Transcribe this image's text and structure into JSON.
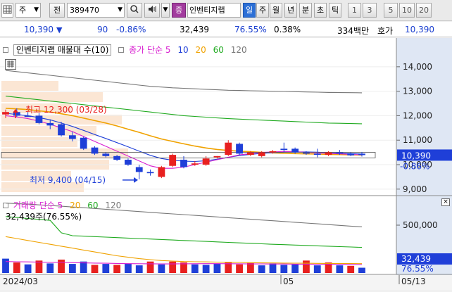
{
  "toolbar": {
    "market_type": "주",
    "code_mode": "전",
    "stock_code": "389470",
    "flag_label": "증",
    "stock_name": "인벤티지랩",
    "periods": [
      "일",
      "주",
      "월",
      "년",
      "분",
      "초",
      "틱"
    ],
    "active_period": "일",
    "intervals": [
      "1",
      "3",
      "5",
      "10",
      "20"
    ]
  },
  "quote": {
    "price": "10,390",
    "direction_arrow": "▼",
    "change": "90",
    "change_pct": "-0.86%",
    "volume": "32,439",
    "volume_ratio": "76.55%",
    "turnover_rate": "0.38%",
    "trade_value": "334백만",
    "ask_label": "호가",
    "ask_price": "10,390"
  },
  "price_panel": {
    "title": "인벤티지랩 매물대 수(10)",
    "ma_label": "종가 단순 5",
    "ma_periods": [
      "10",
      "20",
      "60",
      "120"
    ],
    "high_annotation": "최고 12,300 (03/28)",
    "low_annotation": "최저 9,400 (04/15)",
    "current_price_tag": "10,390",
    "current_change_tag": "-0.86%"
  },
  "volume_panel": {
    "title": "거래량 단순 5",
    "ma_periods": [
      "20",
      "60",
      "120"
    ],
    "current_label": "32,439주(76.55%)",
    "current_value_tag": "32,439",
    "current_pct_tag": "76.55%"
  },
  "x_axis": {
    "labels": [
      "2024/03",
      "05",
      "05/13"
    ]
  },
  "colors": {
    "up": "#e8201f",
    "down": "#1f3fd8",
    "ma5": "#d81fd0",
    "ma10": "#1f3fd8",
    "ma20": "#f0a200",
    "ma60": "#1faa1f",
    "ma120": "#777777",
    "current_tag": "#1f3fd8"
  },
  "chart_data": {
    "type": "candlestick",
    "price_axis": {
      "ticks": [
        9000,
        10000,
        11000,
        12000,
        13000,
        14000
      ],
      "tick_labels": [
        "9,000",
        "10,000",
        "11,000",
        "12,000",
        "13,000",
        "14,000"
      ],
      "ylim": [
        8850,
        14600
      ]
    },
    "volume_axis": {
      "ticks": [
        500000,
        1000000
      ],
      "tick_labels": [
        "500,000"
      ],
      "ylim": [
        0,
        750000
      ]
    },
    "candles": [
      {
        "o": 12050,
        "h": 12250,
        "l": 11900,
        "c": 12150
      },
      {
        "o": 12150,
        "h": 12300,
        "l": 11950,
        "c": 12000
      },
      {
        "o": 12000,
        "h": 12150,
        "l": 11950,
        "c": 11950
      },
      {
        "o": 12000,
        "h": 12100,
        "l": 11650,
        "c": 11700
      },
      {
        "o": 11700,
        "h": 11850,
        "l": 11450,
        "c": 11600
      },
      {
        "o": 11650,
        "h": 11750,
        "l": 11150,
        "c": 11200
      },
      {
        "o": 11200,
        "h": 11350,
        "l": 10950,
        "c": 11050
      },
      {
        "o": 11100,
        "h": 11150,
        "l": 10600,
        "c": 10650
      },
      {
        "o": 10700,
        "h": 10750,
        "l": 10400,
        "c": 10450
      },
      {
        "o": 10450,
        "h": 10500,
        "l": 10300,
        "c": 10350
      },
      {
        "o": 10350,
        "h": 10400,
        "l": 10150,
        "c": 10200
      },
      {
        "o": 10200,
        "h": 10250,
        "l": 9950,
        "c": 10000
      },
      {
        "o": 9900,
        "h": 10000,
        "l": 9400,
        "c": 9700
      },
      {
        "o": 9700,
        "h": 9800,
        "l": 9550,
        "c": 9650
      },
      {
        "o": 9500,
        "h": 9950,
        "l": 9450,
        "c": 9900
      },
      {
        "o": 9950,
        "h": 10450,
        "l": 9900,
        "c": 10400
      },
      {
        "o": 10200,
        "h": 10350,
        "l": 9850,
        "c": 9900
      },
      {
        "o": 10000,
        "h": 10150,
        "l": 9950,
        "c": 10050
      },
      {
        "o": 10000,
        "h": 10350,
        "l": 9950,
        "c": 10250
      },
      {
        "o": 10300,
        "h": 10350,
        "l": 10250,
        "c": 10350
      },
      {
        "o": 10400,
        "h": 11000,
        "l": 10350,
        "c": 10900
      },
      {
        "o": 10850,
        "h": 10900,
        "l": 10400,
        "c": 10450
      },
      {
        "o": 10400,
        "h": 10550,
        "l": 10350,
        "c": 10500
      },
      {
        "o": 10350,
        "h": 10550,
        "l": 10300,
        "c": 10500
      },
      {
        "o": 10500,
        "h": 10600,
        "l": 10450,
        "c": 10550
      },
      {
        "o": 10650,
        "h": 10900,
        "l": 10500,
        "c": 10600
      },
      {
        "o": 10650,
        "h": 10700,
        "l": 10450,
        "c": 10500
      },
      {
        "o": 10500,
        "h": 10550,
        "l": 10400,
        "c": 10450
      },
      {
        "o": 10450,
        "h": 10650,
        "l": 10300,
        "c": 10400
      },
      {
        "o": 10400,
        "h": 10550,
        "l": 10350,
        "c": 10500
      },
      {
        "o": 10500,
        "h": 10600,
        "l": 10400,
        "c": 10450
      },
      {
        "o": 10450,
        "h": 10500,
        "l": 10350,
        "c": 10380
      },
      {
        "o": 10450,
        "h": 10520,
        "l": 10330,
        "c": 10390
      }
    ],
    "volume": [
      {
        "v": 150000,
        "up": false
      },
      {
        "v": 110000,
        "up": true
      },
      {
        "v": 90000,
        "up": false
      },
      {
        "v": 130000,
        "up": true
      },
      {
        "v": 100000,
        "up": false
      },
      {
        "v": 140000,
        "up": true
      },
      {
        "v": 95000,
        "up": false
      },
      {
        "v": 120000,
        "up": false
      },
      {
        "v": 85000,
        "up": true
      },
      {
        "v": 95000,
        "up": false
      },
      {
        "v": 85000,
        "up": true
      },
      {
        "v": 100000,
        "up": false
      },
      {
        "v": 80000,
        "up": false
      },
      {
        "v": 120000,
        "up": true
      },
      {
        "v": 90000,
        "up": false
      },
      {
        "v": 120000,
        "up": true
      },
      {
        "v": 110000,
        "up": true
      },
      {
        "v": 90000,
        "up": false
      },
      {
        "v": 85000,
        "up": false
      },
      {
        "v": 100000,
        "up": false
      },
      {
        "v": 115000,
        "up": true
      },
      {
        "v": 90000,
        "up": true
      },
      {
        "v": 105000,
        "up": true
      },
      {
        "v": 80000,
        "up": false
      },
      {
        "v": 100000,
        "up": false
      },
      {
        "v": 85000,
        "up": false
      },
      {
        "v": 90000,
        "up": false
      },
      {
        "v": 130000,
        "up": true
      },
      {
        "v": 80000,
        "up": false
      },
      {
        "v": 110000,
        "up": true
      },
      {
        "v": 80000,
        "up": false
      },
      {
        "v": 75000,
        "up": true
      },
      {
        "v": 55000,
        "up": false
      }
    ],
    "ma": {
      "ma120": [
        13850,
        13800,
        13750,
        13700,
        13650,
        13600,
        13550,
        13500,
        13450,
        13400,
        13350,
        13300,
        13250,
        13200,
        13170,
        13140,
        13120,
        13100,
        13080,
        13060,
        13040,
        13030,
        13020,
        13010,
        13000,
        12990,
        12980,
        12970,
        12960,
        12950,
        12945,
        12940,
        12935
      ],
      "ma60": [
        12800,
        12750,
        12700,
        12650,
        12600,
        12550,
        12500,
        12450,
        12400,
        12350,
        12300,
        12250,
        12200,
        12150,
        12100,
        12050,
        12000,
        11970,
        11940,
        11910,
        11880,
        11860,
        11840,
        11820,
        11800,
        11780,
        11760,
        11740,
        11720,
        11700,
        11690,
        11680,
        11670
      ],
      "ma20": [
        12300,
        12280,
        12250,
        12200,
        12150,
        12080,
        12000,
        11900,
        11800,
        11700,
        11580,
        11450,
        11320,
        11180,
        11050,
        10950,
        10850,
        10760,
        10680,
        10620,
        10580,
        10550,
        10530,
        10500,
        10480,
        10460,
        10450,
        10440,
        10430,
        10420,
        10410,
        10400,
        10395
      ],
      "ma10": [
        12100,
        12050,
        12000,
        11920,
        11830,
        11700,
        11560,
        11400,
        11230,
        11070,
        10900,
        10730,
        10550,
        10380,
        10250,
        10180,
        10140,
        10130,
        10160,
        10220,
        10300,
        10370,
        10420,
        10460,
        10490,
        10510,
        10520,
        10520,
        10510,
        10490,
        10470,
        10450,
        10430
      ],
      "ma5": [
        12000,
        11950,
        11880,
        11780,
        11650,
        11500,
        11350,
        11150,
        10950,
        10750,
        10550,
        10350,
        10150,
        9950,
        9850,
        9850,
        9900,
        10000,
        10100,
        10200,
        10300,
        10400,
        10450,
        10500,
        10520,
        10540,
        10530,
        10500,
        10480,
        10460,
        10440,
        10420,
        10400
      ],
      "vol_ma5": [
        120000,
        118000,
        116000,
        114000,
        112000,
        110000,
        108000,
        106000,
        104000,
        102000,
        100000,
        98000,
        97000,
        96000,
        95000,
        95000,
        96000,
        97000,
        98000,
        98000,
        97000,
        96000,
        95000,
        95000,
        94000,
        94000,
        93000,
        93000,
        92000,
        92000,
        91000,
        90000,
        88000
      ],
      "vol_ma20": [
        380000,
        360000,
        340000,
        320000,
        300000,
        280000,
        260000,
        240000,
        220000,
        200000,
        180000,
        165000,
        150000,
        140000,
        130000,
        125000,
        120000,
        118000,
        116000,
        114000,
        112000,
        110000,
        108000,
        106000,
        105000,
        104000,
        103000,
        102000,
        101000,
        100000,
        100000,
        99000,
        98000
      ],
      "vol_ma60": [
        590000,
        580000,
        570000,
        560000,
        550000,
        420000,
        390000,
        385000,
        380000,
        375000,
        370000,
        365000,
        360000,
        355000,
        350000,
        345000,
        340000,
        335000,
        330000,
        325000,
        320000,
        315000,
        310000,
        305000,
        300000,
        296000,
        292000,
        288000,
        284000,
        280000,
        276000,
        272000,
        268000
      ],
      "vol_ma120": [
        730000,
        725000,
        720000,
        712000,
        705000,
        698000,
        690000,
        682000,
        674000,
        666000,
        658000,
        650000,
        642000,
        634000,
        626000,
        618000,
        610000,
        602000,
        594000,
        586000,
        578000,
        570000,
        562000,
        554000,
        546000,
        538000,
        530000,
        522000,
        514000,
        506000,
        498000,
        490000,
        482000
      ]
    },
    "volume_profile": [
      0.45,
      0.8,
      0.55,
      0.95,
      0.75,
      0.6,
      1.0,
      0.85,
      0.55,
      0.65
    ]
  }
}
